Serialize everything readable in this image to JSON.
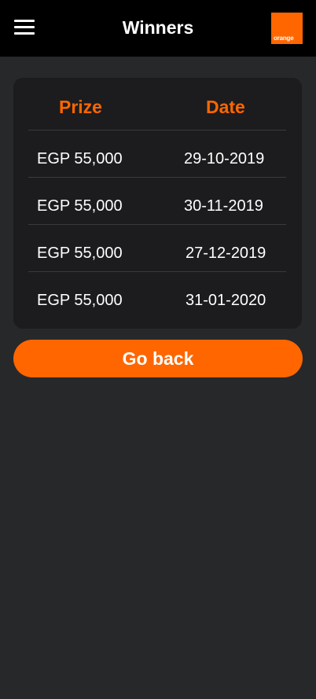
{
  "header": {
    "title": "Winners",
    "logo_text": "orange",
    "brand_color": "#ff6600"
  },
  "table": {
    "columns": [
      "Prize",
      "Date"
    ],
    "rows": [
      {
        "prize": "EGP 55,000",
        "date": "29-10-2019"
      },
      {
        "prize": "EGP 55,000",
        "date": "30-11-2019"
      },
      {
        "prize": "EGP 55,000",
        "date": "27-12-2019"
      },
      {
        "prize": "EGP 55,000",
        "date": "31-01-2020"
      }
    ]
  },
  "actions": {
    "back_label": "Go back"
  }
}
